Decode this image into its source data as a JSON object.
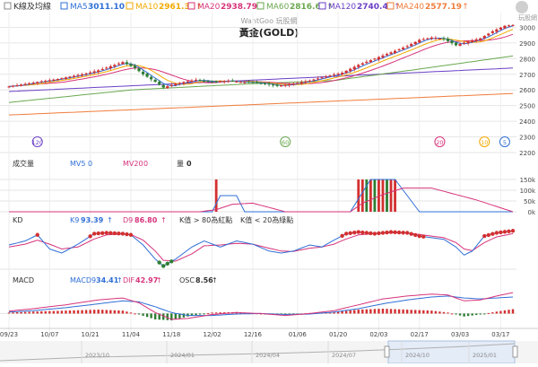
{
  "colors": {
    "up": "#d32f2f",
    "down": "#2e7d32",
    "ma5": "#2f6fd6",
    "ma10": "#f2a900",
    "ma20": "#d6337a",
    "ma60": "#6aa84f",
    "ma120": "#6a3fc6",
    "ma240": "#f07c3b",
    "k": "#2f6fd6",
    "d": "#d6337a",
    "grid": "#e6e6e6",
    "text": "#444444"
  },
  "header": {
    "legend_title": "K線及均線",
    "ma_items": [
      {
        "key": "ma5",
        "label": "MA5",
        "value": "3011.10",
        "arrow": "↑"
      },
      {
        "key": "ma10",
        "label": "MA10",
        "value": "2961.38",
        "arrow": "↑"
      },
      {
        "key": "ma20",
        "label": "MA20",
        "value": "2938.79",
        "arrow": "↑"
      },
      {
        "key": "ma60",
        "label": "MA60",
        "value": "2816.67",
        "arrow": "↑"
      },
      {
        "key": "ma120",
        "label": "MA120",
        "value": "2740.49",
        "arrow": "↑"
      },
      {
        "key": "ma240",
        "label": "MA240",
        "value": "2577.19",
        "arrow": "↑"
      }
    ],
    "watermark": "WantGoo 玩股網",
    "logo_text": "玩股網"
  },
  "volume_panel": {
    "title": "成交量",
    "mv5_label": "MV5",
    "mv5_value": "0",
    "mv20_label": "MV20",
    "mv20_value": "0",
    "qty_label": "量",
    "qty_value": "0"
  },
  "kd_panel": {
    "title": "KD",
    "k_label": "K9",
    "k_value": "93.39",
    "k_arrow": "↑",
    "d_label": "D9",
    "d_value": "86.80",
    "d_arrow": "↑",
    "note_red": "K值 > 80為紅點",
    "note_green": "K值 < 20為綠點"
  },
  "macd_panel": {
    "title": "MACD",
    "macd_label": "MACD9",
    "macd_value": "34.41",
    "macd_arrow": "↑",
    "dif_label": "DIF",
    "dif_value": "42.97",
    "dif_arrow": "↑",
    "osc_label": "OSC",
    "osc_value": "8.56",
    "osc_arrow": "↑"
  },
  "chart_data": [
    {
      "type": "candlestick",
      "title": "黃金(GOLD)",
      "y_ticks": [
        2200,
        2300,
        2400,
        2500,
        2600,
        2700,
        2800,
        2900,
        3000
      ],
      "ylim": [
        2200,
        3060
      ],
      "x_tick_labels": [
        "09/23",
        "10/07",
        "10/21",
        "11/04",
        "11/18",
        "12/02",
        "12/16",
        "01/06",
        "01/20",
        "02/03",
        "02/17",
        "03/03",
        "03/17"
      ],
      "x_tick_index": [
        0,
        10,
        20,
        30,
        40,
        50,
        60,
        71,
        81,
        91,
        101,
        111,
        121
      ],
      "ohlc_anchor_close": [
        [
          0,
          2622
        ],
        [
          8,
          2655
        ],
        [
          12,
          2670
        ],
        [
          18,
          2700
        ],
        [
          22,
          2725
        ],
        [
          26,
          2760
        ],
        [
          28,
          2778
        ],
        [
          31,
          2740
        ],
        [
          33,
          2700
        ],
        [
          36,
          2652
        ],
        [
          38,
          2615
        ],
        [
          41,
          2640
        ],
        [
          46,
          2665
        ],
        [
          50,
          2650
        ],
        [
          54,
          2660
        ],
        [
          57,
          2650
        ],
        [
          60,
          2648
        ],
        [
          63,
          2640
        ],
        [
          66,
          2625
        ],
        [
          70,
          2640
        ],
        [
          74,
          2660
        ],
        [
          77,
          2680
        ],
        [
          82,
          2710
        ],
        [
          86,
          2760
        ],
        [
          90,
          2800
        ],
        [
          94,
          2840
        ],
        [
          98,
          2880
        ],
        [
          101,
          2920
        ],
        [
          104,
          2935
        ],
        [
          107,
          2925
        ],
        [
          110,
          2885
        ],
        [
          113,
          2910
        ],
        [
          116,
          2930
        ],
        [
          119,
          2975
        ],
        [
          122,
          3010
        ],
        [
          124,
          3015
        ]
      ],
      "ma_labels_on_chart": [
        {
          "label": "120",
          "index": 7,
          "color": "#6a3fc6"
        },
        {
          "label": "60",
          "index": 68,
          "color": "#6aa84f"
        },
        {
          "label": "20",
          "index": 106,
          "color": "#d6337a"
        },
        {
          "label": "10",
          "index": 117,
          "color": "#f2a900"
        },
        {
          "label": "5",
          "index": 122,
          "color": "#2f6fd6"
        }
      ]
    },
    {
      "type": "bar",
      "title": "成交量",
      "y_ticks": [
        "150k",
        "100k",
        "50k",
        "0k"
      ],
      "ylim": [
        0,
        150
      ],
      "bars": [
        {
          "index": 51,
          "value": 150,
          "color": "#d32f2f"
        },
        {
          "index": 86,
          "value": 150,
          "color": "#d32f2f"
        },
        {
          "index": 87,
          "value": 150,
          "color": "#d32f2f"
        },
        {
          "index": 88,
          "value": 150,
          "color": "#2e7d32"
        },
        {
          "index": 89,
          "value": 150,
          "color": "#d32f2f"
        },
        {
          "index": 90,
          "value": 150,
          "color": "#2e7d32"
        },
        {
          "index": 91,
          "value": 150,
          "color": "#d32f2f"
        },
        {
          "index": 92,
          "value": 150,
          "color": "#d32f2f"
        },
        {
          "index": 93,
          "value": 150,
          "color": "#2e7d32"
        },
        {
          "index": 94,
          "value": 150,
          "color": "#d32f2f"
        },
        {
          "index": 95,
          "value": 150,
          "color": "#d32f2f"
        }
      ],
      "mv5_points": [
        [
          0,
          0
        ],
        [
          50,
          0
        ],
        [
          52,
          75
        ],
        [
          56,
          75
        ],
        [
          58,
          0
        ],
        [
          84,
          0
        ],
        [
          86,
          60
        ],
        [
          89,
          150
        ],
        [
          95,
          150
        ],
        [
          101,
          0
        ],
        [
          124,
          0
        ]
      ],
      "mv20_points": [
        [
          0,
          0
        ],
        [
          47,
          0
        ],
        [
          51,
          10
        ],
        [
          55,
          35
        ],
        [
          60,
          40
        ],
        [
          68,
          0
        ],
        [
          84,
          0
        ],
        [
          87,
          40
        ],
        [
          92,
          80
        ],
        [
          97,
          110
        ],
        [
          104,
          110
        ],
        [
          115,
          55
        ],
        [
          124,
          0
        ]
      ]
    },
    {
      "type": "line",
      "title": "KD",
      "ylim": [
        0,
        100
      ],
      "k_anchor": [
        [
          0,
          60
        ],
        [
          4,
          70
        ],
        [
          7,
          85
        ],
        [
          10,
          50
        ],
        [
          13,
          40
        ],
        [
          17,
          62
        ],
        [
          21,
          88
        ],
        [
          24,
          90
        ],
        [
          28,
          88
        ],
        [
          30,
          85
        ],
        [
          33,
          60
        ],
        [
          36,
          25
        ],
        [
          38,
          8
        ],
        [
          41,
          25
        ],
        [
          45,
          55
        ],
        [
          48,
          70
        ],
        [
          52,
          55
        ],
        [
          56,
          70
        ],
        [
          60,
          62
        ],
        [
          64,
          45
        ],
        [
          67,
          40
        ],
        [
          70,
          45
        ],
        [
          74,
          60
        ],
        [
          77,
          55
        ],
        [
          80,
          72
        ],
        [
          83,
          88
        ],
        [
          86,
          92
        ],
        [
          90,
          88
        ],
        [
          94,
          92
        ],
        [
          98,
          90
        ],
        [
          101,
          82
        ],
        [
          104,
          78
        ],
        [
          107,
          74
        ],
        [
          110,
          55
        ],
        [
          112,
          35
        ],
        [
          114,
          45
        ],
        [
          117,
          82
        ],
        [
          120,
          90
        ],
        [
          124,
          95
        ]
      ],
      "d_anchor": [
        [
          0,
          55
        ],
        [
          4,
          62
        ],
        [
          7,
          72
        ],
        [
          10,
          62
        ],
        [
          13,
          50
        ],
        [
          17,
          55
        ],
        [
          21,
          75
        ],
        [
          24,
          85
        ],
        [
          28,
          87
        ],
        [
          30,
          86
        ],
        [
          33,
          72
        ],
        [
          36,
          45
        ],
        [
          38,
          22
        ],
        [
          41,
          20
        ],
        [
          45,
          38
        ],
        [
          48,
          58
        ],
        [
          52,
          60
        ],
        [
          56,
          64
        ],
        [
          60,
          62
        ],
        [
          64,
          52
        ],
        [
          67,
          45
        ],
        [
          70,
          44
        ],
        [
          74,
          52
        ],
        [
          77,
          55
        ],
        [
          80,
          62
        ],
        [
          83,
          75
        ],
        [
          86,
          85
        ],
        [
          90,
          88
        ],
        [
          94,
          90
        ],
        [
          98,
          90
        ],
        [
          101,
          86
        ],
        [
          104,
          82
        ],
        [
          107,
          78
        ],
        [
          110,
          66
        ],
        [
          112,
          50
        ],
        [
          114,
          46
        ],
        [
          117,
          66
        ],
        [
          120,
          80
        ],
        [
          124,
          88
        ]
      ]
    },
    {
      "type": "bar",
      "title": "MACD",
      "ylim": [
        -25,
        45
      ],
      "dif_anchor": [
        [
          0,
          5
        ],
        [
          6,
          10
        ],
        [
          14,
          18
        ],
        [
          22,
          28
        ],
        [
          28,
          32
        ],
        [
          32,
          22
        ],
        [
          36,
          2
        ],
        [
          40,
          -12
        ],
        [
          44,
          -10
        ],
        [
          50,
          -2
        ],
        [
          56,
          2
        ],
        [
          62,
          0
        ],
        [
          68,
          -4
        ],
        [
          74,
          0
        ],
        [
          80,
          6
        ],
        [
          86,
          18
        ],
        [
          92,
          30
        ],
        [
          98,
          36
        ],
        [
          104,
          40
        ],
        [
          108,
          38
        ],
        [
          112,
          26
        ],
        [
          116,
          28
        ],
        [
          120,
          36
        ],
        [
          124,
          43
        ]
      ],
      "macd_anchor": [
        [
          0,
          3
        ],
        [
          6,
          6
        ],
        [
          14,
          12
        ],
        [
          22,
          20
        ],
        [
          28,
          26
        ],
        [
          32,
          24
        ],
        [
          36,
          14
        ],
        [
          40,
          2
        ],
        [
          44,
          -4
        ],
        [
          50,
          -4
        ],
        [
          56,
          -1
        ],
        [
          62,
          0
        ],
        [
          68,
          -2
        ],
        [
          74,
          -1
        ],
        [
          80,
          3
        ],
        [
          86,
          10
        ],
        [
          92,
          20
        ],
        [
          98,
          28
        ],
        [
          104,
          34
        ],
        [
          108,
          36
        ],
        [
          112,
          32
        ],
        [
          116,
          30
        ],
        [
          120,
          32
        ],
        [
          124,
          34
        ]
      ]
    }
  ],
  "x_axis": {
    "date_labels": [
      "09/23",
      "10/07",
      "10/21",
      "11/04",
      "11/18",
      "12/02",
      "12/16",
      "01/06",
      "01/20",
      "02/03",
      "02/17",
      "03/03",
      "03/17"
    ],
    "navigator_labels": [
      "2023/10",
      "2024/01",
      "2024/04",
      "2024/07",
      "2024/10",
      "2025/01"
    ]
  }
}
